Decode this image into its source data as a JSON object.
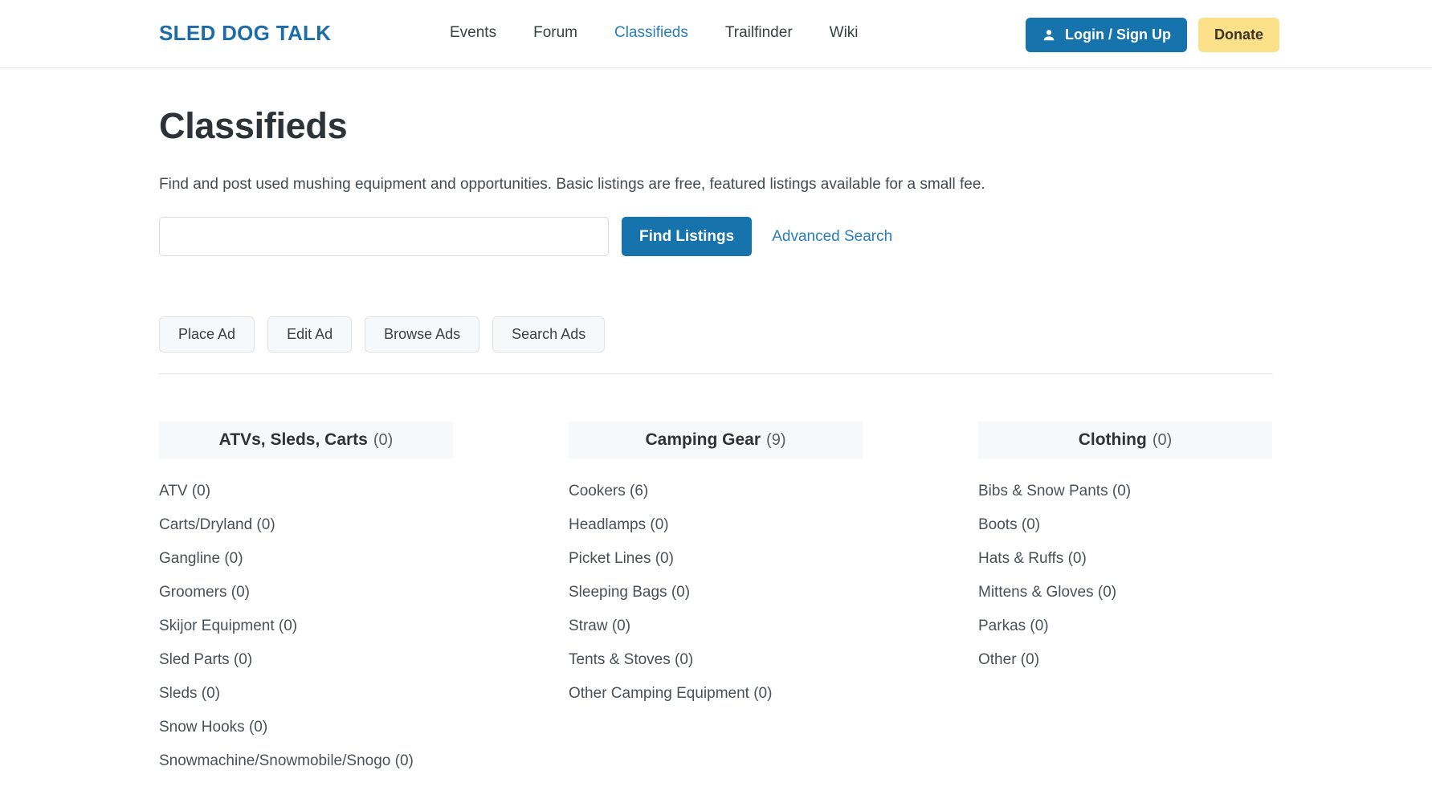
{
  "header": {
    "brand": "SLED DOG TALK",
    "nav": [
      {
        "label": "Events",
        "active": false
      },
      {
        "label": "Forum",
        "active": false
      },
      {
        "label": "Classifieds",
        "active": true
      },
      {
        "label": "Trailfinder",
        "active": false
      },
      {
        "label": "Wiki",
        "active": false
      }
    ],
    "login_label": "Login / Sign Up",
    "donate_label": "Donate",
    "login_icon": "person-icon",
    "accent_blue": "#1673ab",
    "donate_yellow": "#fbe08a",
    "link_blue": "#2a7fb8"
  },
  "main": {
    "title": "Classifieds",
    "description": "Find and post used mushing equipment and opportunities. Basic listings are free, featured listings available for a small fee.",
    "search": {
      "value": "",
      "placeholder": "",
      "submit_label": "Find Listings",
      "advanced_label": "Advanced Search"
    },
    "actions": [
      {
        "label": "Place Ad"
      },
      {
        "label": "Edit Ad"
      },
      {
        "label": "Browse Ads"
      },
      {
        "label": "Search Ads"
      }
    ],
    "categories": [
      {
        "title": "ATVs, Sleds, Carts",
        "count": "(0)",
        "items": [
          {
            "label": "ATV (0)"
          },
          {
            "label": "Carts/Dryland (0)"
          },
          {
            "label": "Gangline (0)"
          },
          {
            "label": "Groomers (0)"
          },
          {
            "label": "Skijor Equipment (0)"
          },
          {
            "label": "Sled Parts (0)"
          },
          {
            "label": "Sleds (0)"
          },
          {
            "label": "Snow Hooks (0)"
          },
          {
            "label": "Snowmachine/Snowmobile/Snogo (0)"
          }
        ]
      },
      {
        "title": "Camping Gear",
        "count": "(9)",
        "items": [
          {
            "label": "Cookers (6)"
          },
          {
            "label": "Headlamps (0)"
          },
          {
            "label": "Picket Lines (0)"
          },
          {
            "label": "Sleeping Bags (0)"
          },
          {
            "label": "Straw (0)"
          },
          {
            "label": "Tents & Stoves (0)"
          },
          {
            "label": "Other Camping Equipment (0)"
          }
        ]
      },
      {
        "title": "Clothing",
        "count": "(0)",
        "items": [
          {
            "label": "Bibs & Snow Pants (0)"
          },
          {
            "label": "Boots (0)"
          },
          {
            "label": "Hats & Ruffs (0)"
          },
          {
            "label": "Mittens & Gloves (0)"
          },
          {
            "label": "Parkas (0)"
          },
          {
            "label": "Other (0)"
          }
        ]
      }
    ]
  }
}
